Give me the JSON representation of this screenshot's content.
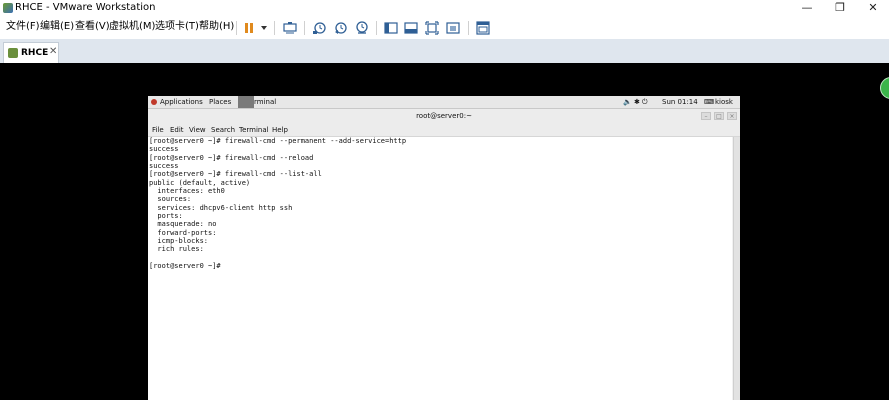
{
  "window": {
    "title": "RHCE - VMware Workstation",
    "minimize_glyph": "—",
    "maximize_glyph": "❐",
    "close_glyph": "✕"
  },
  "menu": {
    "items": [
      "文件(F)",
      "编辑(E)",
      "查看(V)",
      "虚拟机(M)",
      "选项卡(T)",
      "帮助(H)"
    ]
  },
  "toolbar": {
    "icons": [
      "pause-icon",
      "dropdown-arrow-icon",
      "send-ctrl-alt-del-icon",
      "snapshot-icon",
      "revert-snapshot-icon",
      "snapshot-manager-icon",
      "library-view-icon",
      "console-view-icon",
      "full-screen-icon",
      "unity-icon",
      "thumbnail-view-icon"
    ]
  },
  "tabs": [
    {
      "label": "RHCE",
      "close_glyph": "✕"
    }
  ],
  "gnome": {
    "applications": "Applications",
    "places": "Places",
    "terminal_partial": "rminal",
    "status_icons": "🔈 ✱ ⏻",
    "clock": "Sun 01:14",
    "user": "kiosk"
  },
  "terminal": {
    "title": "root@server0:~",
    "window_buttons": [
      "–",
      "□",
      "×"
    ],
    "menu": [
      "File",
      "Edit",
      "View",
      "Search",
      "Terminal",
      "Help"
    ],
    "lines": [
      "[root@server0 ~]# firewall-cmd --permanent --add-service=http",
      "success",
      "[root@server0 ~]# firewall-cmd --reload",
      "success",
      "[root@server0 ~]# firewall-cmd --list-all",
      "public (default, active)",
      "  interfaces: eth0",
      "  sources:",
      "  services: dhcpv6-client http ssh",
      "  ports:",
      "  masquerade: no",
      "  forward-ports:",
      "  icmp-blocks:",
      "  rich rules:",
      "",
      "[root@server0 ~]#"
    ]
  },
  "colors": {
    "vm_background": "#000000",
    "tab_row": "#dfe6ee",
    "pause_icon": "#e08a1e",
    "toolbar_icon": "#2f5f95"
  }
}
